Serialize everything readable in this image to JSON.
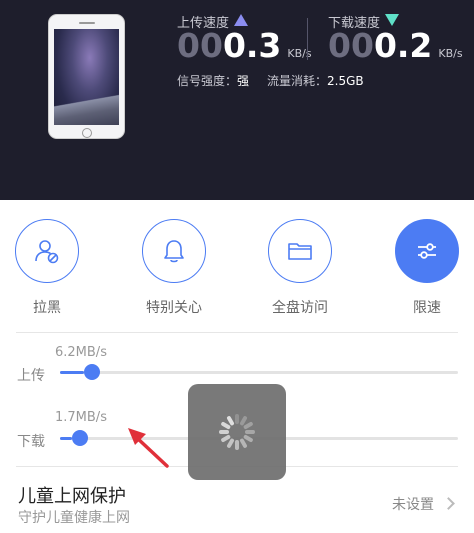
{
  "device": {
    "icon": "iphone-icon"
  },
  "upload": {
    "label": "上传速度",
    "digits_dim": "00",
    "digits": "0.3",
    "unit": "KB/s",
    "color": "#8b8df0"
  },
  "download": {
    "label": "下载速度",
    "digits_dim": "00",
    "digits": "0.2",
    "unit": "KB/s",
    "color": "#5fe0c8"
  },
  "stats": {
    "signal_label": "信号强度：",
    "signal_value": "强",
    "traffic_label": "流量消耗：",
    "traffic_value": "2.5GB"
  },
  "actions": [
    {
      "label": "拉黑",
      "icon": "block-user-icon",
      "active": false
    },
    {
      "label": "特别关心",
      "icon": "bell-icon",
      "active": false
    },
    {
      "label": "全盘访问",
      "icon": "folder-icon",
      "active": false
    },
    {
      "label": "限速",
      "icon": "sliders-icon",
      "active": true
    }
  ],
  "limits": {
    "upload": {
      "label": "上传",
      "rate": "6.2MB/s",
      "level": 0.06
    },
    "download": {
      "label": "下载",
      "rate": "1.7MB/s",
      "level": 0.03
    }
  },
  "kids": {
    "title": "儿童上网保护",
    "subtitle": "守护儿童健康上网",
    "status": "未设置"
  },
  "colors": {
    "accent": "#4c7cf3",
    "header_bg": "#1e1e2c",
    "pointer": "#e0303a"
  },
  "overlay": {
    "icon": "loading-spinner-icon"
  }
}
